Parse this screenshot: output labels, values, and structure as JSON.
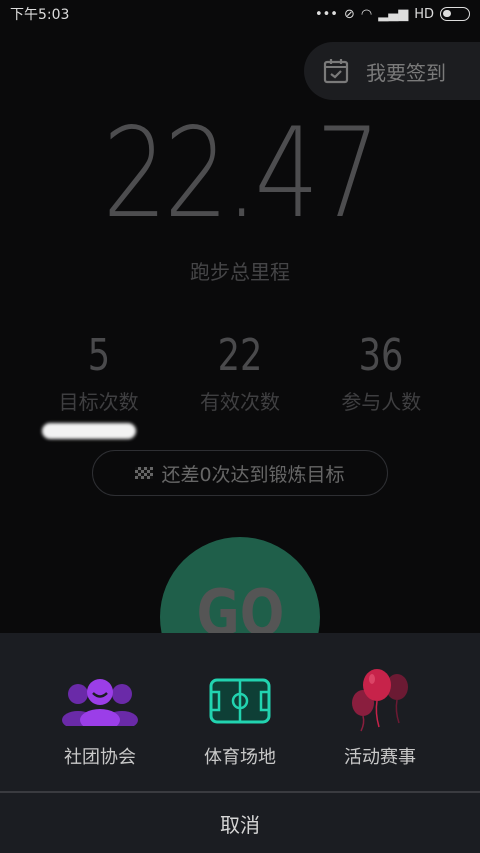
{
  "status_bar": {
    "time": "下午5:03",
    "network": "HD"
  },
  "checkin": {
    "label": "我要签到"
  },
  "distance": {
    "value": "22.47",
    "label": "跑步总里程"
  },
  "stats": [
    {
      "value": "5",
      "label": "目标次数"
    },
    {
      "value": "22",
      "label": "有效次数"
    },
    {
      "value": "36",
      "label": "参与人数"
    }
  ],
  "goal": {
    "text": "还差0次达到锻炼目标"
  },
  "go": {
    "label": "GO"
  },
  "sheet": {
    "options": [
      {
        "label": "社团协会",
        "icon": "group-icon"
      },
      {
        "label": "体育场地",
        "icon": "field-icon"
      },
      {
        "label": "活动赛事",
        "icon": "balloons-icon"
      }
    ],
    "cancel": "取消"
  },
  "colors": {
    "accent_purple": "#8e3bd8",
    "accent_teal": "#22d3b0",
    "accent_red": "#c7234a"
  }
}
